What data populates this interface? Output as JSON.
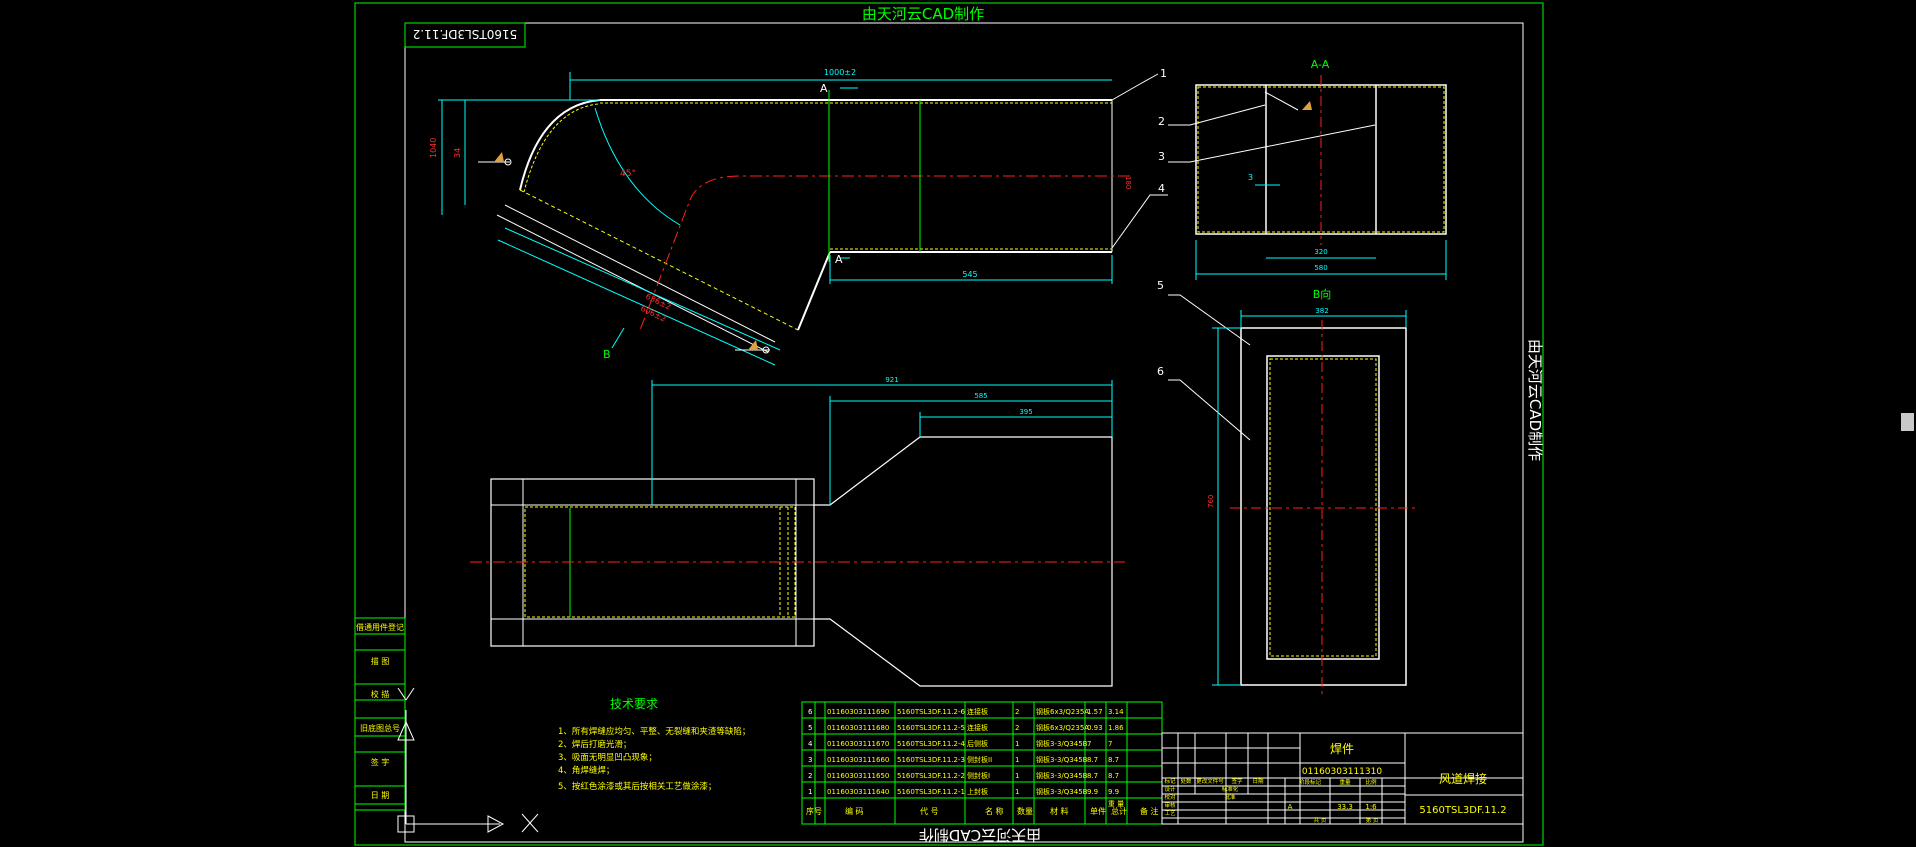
{
  "watermark": "由天河云CAD制作",
  "drawing_code_mirror": "5160TSL3DF.11.2",
  "callouts": [
    "1",
    "2",
    "3",
    "4",
    "5",
    "6"
  ],
  "section_labels": {
    "a": "A",
    "section_aa": "A-A",
    "b": "B",
    "view_b": "B向"
  },
  "dims": {
    "d_top": "1000±2",
    "d_545": "545",
    "d_h1": "1040",
    "d_h2": "34",
    "d_angle": "45°",
    "d_diag1": "636±2",
    "d_diag2": "606±2",
    "d_right_red": "180",
    "d_921": "921",
    "d_585": "585",
    "d_395": "395",
    "d_aa_3": "3",
    "d_aa_320": "320",
    "d_aa_580": "580",
    "d_b_382": "382",
    "d_b_h": "760"
  },
  "tech_title": "技术要求",
  "tech_items": [
    "1、所有焊缝应均匀、平整、无裂缝和夹渣等缺陷；",
    "2、焊后打磨光滑；",
    "3、吸面无明显凹凸现象；",
    "4、角焊缝焊；",
    "5、按红色涂漆或其后按相关工艺做涂漆；"
  ],
  "left_strip": [
    "借通用件登记",
    "描 图",
    "校 描",
    "旧底图总号",
    "签 字",
    "日 期"
  ],
  "bom_rows": [
    [
      "6",
      "01160303111690",
      "5160TSL3DF.11.2-6",
      "连接板",
      "2",
      "钢板6x3/Q235A",
      "1.57",
      "3.14"
    ],
    [
      "5",
      "01160303111680",
      "5160TSL3DF.11.2-5",
      "连接板",
      "2",
      "钢板6x3/Q235A",
      "0.93",
      "1.86"
    ],
    [
      "4",
      "01160303111670",
      "5160TSL3DF.11.2-4",
      "后侧板",
      "1",
      "钢板3-3/Q345B",
      "7",
      "7"
    ],
    [
      "3",
      "01160303111660",
      "5160TSL3DF.11.2-3",
      "侧封板II",
      "1",
      "钢板3-3/Q345B",
      "8.7",
      "8.7"
    ],
    [
      "2",
      "01160303111650",
      "5160TSL3DF.11.2-2",
      "侧封板I",
      "1",
      "钢板3-3/Q345B",
      "8.7",
      "8.7"
    ],
    [
      "1",
      "01160303111640",
      "5160TSL3DF.11.2-1",
      "上封板",
      "1",
      "钢板3-3/Q345B",
      "9.9",
      "9.9"
    ]
  ],
  "bom_header": [
    "序号",
    "编 码",
    "代 号",
    "名 称",
    "数量",
    "材 料",
    "单件",
    "总计",
    "备 注"
  ],
  "bom_sub": [
    "重 量"
  ],
  "title_block": {
    "material_label": "焊件",
    "code": "01160303111310",
    "name": "风道焊接",
    "drawing_no": "5160TSL3DF.11.2",
    "mass": "33.3",
    "scale": "1:6",
    "stage": "A",
    "small_labels": [
      "标记",
      "处数",
      "更改文件号",
      "签字",
      "日期",
      "设计",
      "校对",
      "审核",
      "工艺",
      "标准化",
      "批准",
      "阶段标记",
      "重量",
      "比例",
      "共 页",
      "第 页"
    ]
  }
}
